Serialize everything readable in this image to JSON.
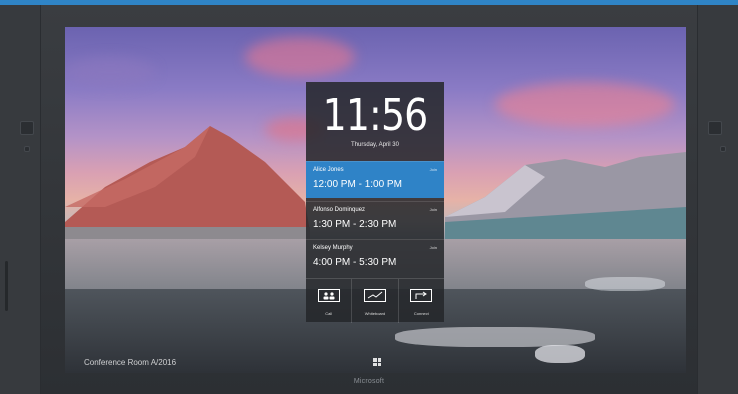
{
  "device": {
    "brand": "Microsoft"
  },
  "screen": {
    "computer_name": "Conference Room A/2016"
  },
  "clock": {
    "time": "11:56",
    "date": "Thursday, April 30"
  },
  "meetings": [
    {
      "name": "Alice Jones",
      "time": "12:00 PM - 1:00 PM",
      "join": "Join",
      "active": true
    },
    {
      "name": "Alfonso Dominquez",
      "time": "1:30 PM - 2:30 PM",
      "join": "Join",
      "active": false
    },
    {
      "name": "Kelsey Murphy",
      "time": "4:00 PM - 5:30 PM",
      "join": "Join",
      "active": false
    }
  ],
  "actions": [
    {
      "label": "Call",
      "icon": "people-icon"
    },
    {
      "label": "Whiteboard",
      "icon": "whiteboard-icon"
    },
    {
      "label": "Connect",
      "icon": "connect-icon"
    }
  ],
  "colors": {
    "accent": "#2f83c7",
    "frame": "#2c2f33",
    "background": "#2f84c6"
  }
}
